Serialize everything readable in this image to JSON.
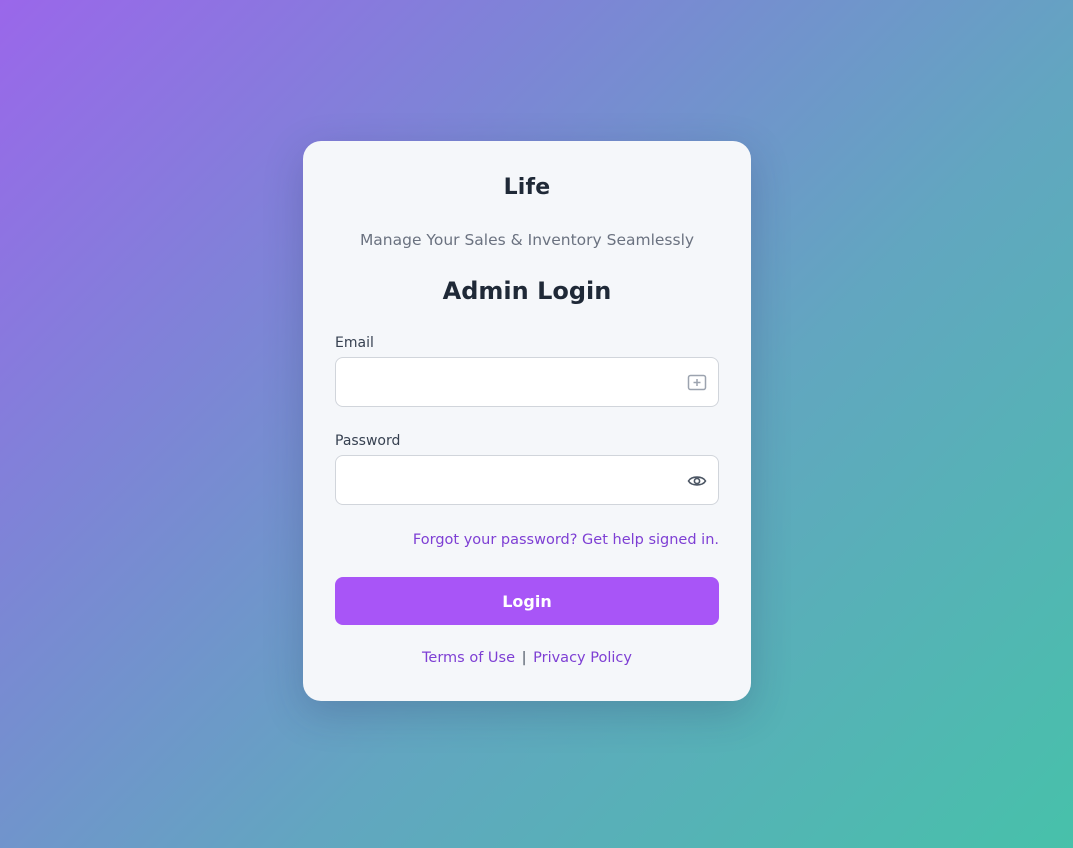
{
  "brand": {
    "name": "Life"
  },
  "tagline": "Manage Your Sales & Inventory Seamlessly",
  "heading": "Admin Login",
  "form": {
    "email": {
      "label": "Email",
      "value": "",
      "placeholder": "",
      "icon": "credential-autofill-icon"
    },
    "password": {
      "label": "Password",
      "value": "",
      "placeholder": "",
      "icon": "eye-icon"
    }
  },
  "forgot_link": "Forgot your password? Get help signed in.",
  "login_button": "Login",
  "footer": {
    "terms": "Terms of Use",
    "separator": "|",
    "privacy": "Privacy Policy"
  },
  "colors": {
    "accent": "#a855f7",
    "link": "#7e3fd4",
    "gradient_start": "#9a67ea",
    "gradient_end": "#47c1aa",
    "card_bg": "#f5f7fa"
  }
}
